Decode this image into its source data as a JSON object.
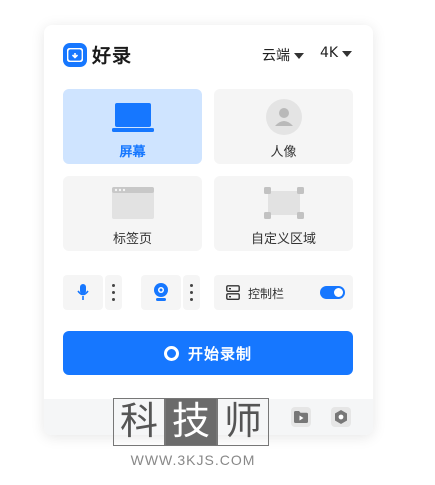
{
  "header": {
    "app_name": "好录",
    "storage_label": "云端",
    "resolution_label": "4K"
  },
  "modes": [
    {
      "label": "屏幕",
      "icon": "laptop-icon",
      "active": true
    },
    {
      "label": "人像",
      "icon": "person-icon",
      "active": false
    },
    {
      "label": "标签页",
      "icon": "browser-tab-icon",
      "active": false
    },
    {
      "label": "自定义区域",
      "icon": "custom-region-icon",
      "active": false
    }
  ],
  "controls": {
    "mic_icon": "microphone-icon",
    "camera_icon": "webcam-icon",
    "toolbar_label": "控制栏",
    "toolbar_enabled": true
  },
  "start_button": {
    "label": "开始录制"
  },
  "footer": {
    "icons": [
      "folder-play-icon",
      "settings-icon"
    ]
  },
  "watermark": {
    "chars": [
      "科",
      "技",
      "师"
    ],
    "url": "WWW.3KJS.COM"
  },
  "colors": {
    "accent": "#1677ff",
    "active_bg": "#cfe4ff",
    "tile_bg": "#f5f5f5"
  }
}
